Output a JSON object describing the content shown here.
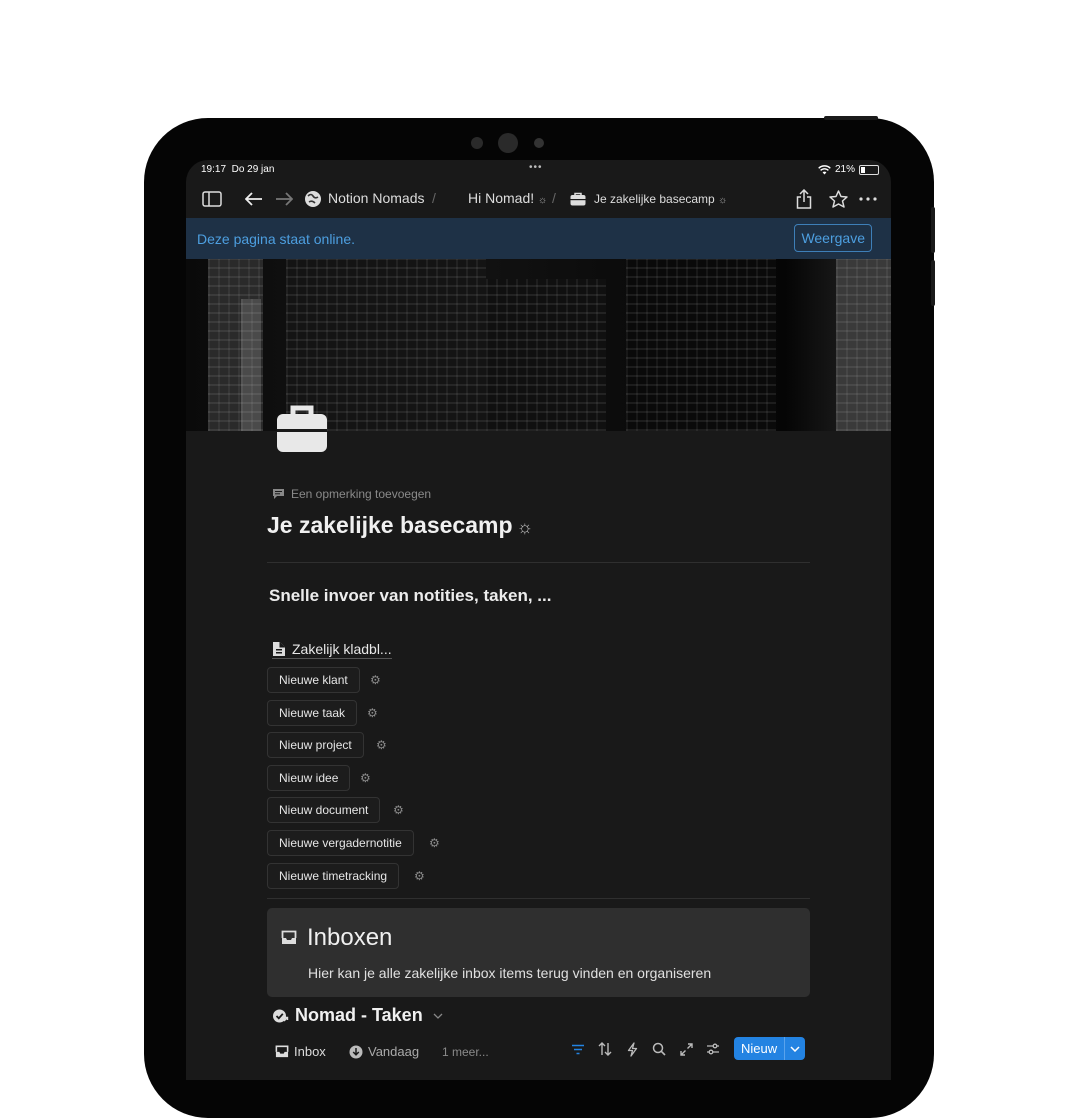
{
  "status_bar": {
    "time": "19:17",
    "date": "Do 29 jan",
    "battery": "21%"
  },
  "nav": {
    "workspace": "Notion Nomads",
    "crumb_1": "Hi Nomad!",
    "crumb_2": "Je zakelijke basecamp",
    "separator": "/",
    "sparkle": "☼"
  },
  "banner": {
    "text": "Deze pagina staat online.",
    "button": "Weergave"
  },
  "page": {
    "add_comment": "Een opmerking toevoegen",
    "title": "Je zakelijke basecamp",
    "title_sparkle": "☼",
    "heading": "Snelle invoer van notities, taken, ...",
    "linked_page": "Zakelijk kladbl..."
  },
  "template_buttons": [
    "Nieuwe klant",
    "Nieuwe taak",
    "Nieuw project",
    "Nieuw idee",
    "Nieuw document",
    "Nieuwe vergadernotitie",
    "Nieuwe timetracking"
  ],
  "callout": {
    "title": "Inboxen",
    "description": "Hier kan je alle zakelijke inbox items terug vinden en organiseren"
  },
  "database": {
    "title": "Nomad - Taken",
    "views": [
      "Inbox",
      "Vandaag"
    ],
    "more_views": "1 meer...",
    "new_button": "Nieuw"
  },
  "colors": {
    "accent": "#2383e2",
    "banner_bg": "#1e3146",
    "banner_text": "#4d9fe0",
    "page_bg": "#191919"
  }
}
